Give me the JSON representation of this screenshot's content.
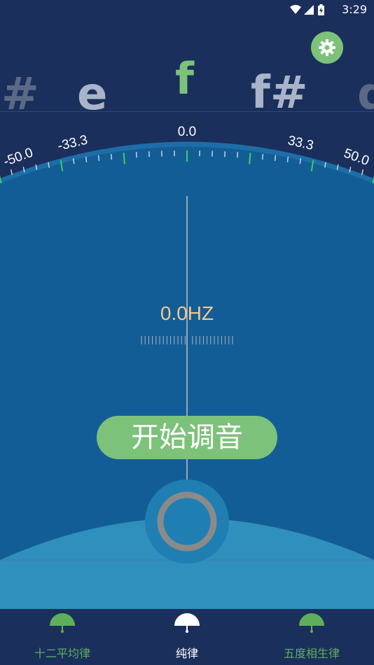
{
  "status_bar": {
    "time": "3:29",
    "icons": [
      "wifi-icon",
      "signal-icon",
      "battery-charging-icon"
    ]
  },
  "settings": {
    "icon": "gear-icon",
    "color": "#7dc27a"
  },
  "notes": [
    "#",
    "e",
    "f",
    "f#",
    "g"
  ],
  "dial": {
    "labels": [
      "-50.0",
      "-33.3",
      "0.0",
      "33.3",
      "50.0"
    ],
    "range": [
      -50,
      50
    ],
    "needle_value": 0
  },
  "frequency": "0.0HZ",
  "start_button": {
    "label": "开始调音",
    "color": "#7dc27a"
  },
  "bottom_nav": {
    "items": [
      {
        "label": "十二平均律",
        "active": false,
        "color": "#5fae5a"
      },
      {
        "label": "纯律",
        "active": true,
        "color": "#ffffff"
      },
      {
        "label": "五度相生律",
        "active": false,
        "color": "#5fae5a"
      }
    ]
  },
  "colors": {
    "background_top": "#1b2f5c",
    "dial_face": "#135d96",
    "accent_green": "#7dc27a",
    "tick_green": "#34d35c",
    "hz_text": "#f3c88f"
  }
}
